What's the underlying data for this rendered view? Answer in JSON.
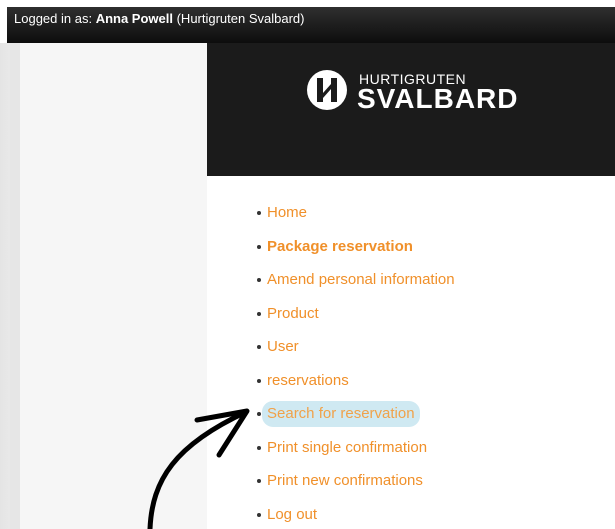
{
  "topbar": {
    "prefix": "Logged in as: ",
    "user_name": "Anna Powell",
    "organization": " (Hurtigruten Svalbard)"
  },
  "logo": {
    "small_text": "HURTIGRUTEN",
    "big_text": "SVALBARD"
  },
  "menu": {
    "items": [
      {
        "label": "Home"
      },
      {
        "label": "Package reservation"
      },
      {
        "label": "Amend personal information"
      },
      {
        "label": "Product"
      },
      {
        "label": "User"
      },
      {
        "label": "reservations"
      },
      {
        "label": "Search for reservation"
      },
      {
        "label": "Print single confirmation"
      },
      {
        "label": "Print new confirmations"
      },
      {
        "label": "Log out"
      }
    ]
  },
  "colors": {
    "link": "#f0902a",
    "highlight": "#cfe9f2",
    "header_bg": "#1b1b1b"
  },
  "icons": {
    "logo_mark": "hurtigruten-h-icon",
    "annotation": "curved-arrow-icon"
  }
}
